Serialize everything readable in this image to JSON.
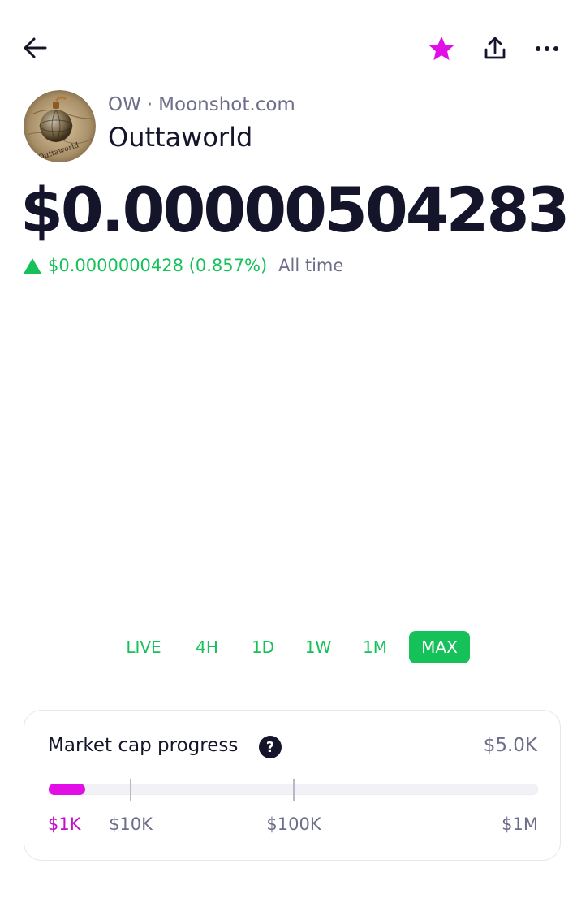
{
  "header": {
    "back_icon": "arrow-left-icon",
    "favorite_icon": "star-icon",
    "share_icon": "share-icon",
    "more_icon": "more-horizontal-icon",
    "favorite_color": "#e10ee6"
  },
  "token": {
    "symbol": "OW",
    "separator": "·",
    "source": "Moonshot.com",
    "name": "Outtaworld",
    "avatar_label": "Outtaworld"
  },
  "price": {
    "current": "$0.00000504283",
    "change": "$0.0000000428 (0.857%)",
    "period": "All time",
    "direction": "up",
    "up_color": "#16c159"
  },
  "range_tabs": {
    "items": [
      {
        "label": "LIVE",
        "active": false
      },
      {
        "label": "4H",
        "active": false
      },
      {
        "label": "1D",
        "active": false
      },
      {
        "label": "1W",
        "active": false
      },
      {
        "label": "1M",
        "active": false
      },
      {
        "label": "MAX",
        "active": true
      }
    ]
  },
  "market_cap": {
    "title": "Market cap progress",
    "help_icon": "question-circle-icon",
    "value": "$5.0K",
    "progress_fraction": 0.074,
    "progress_color": "#e10ee6",
    "scale": [
      "$1K",
      "$10K",
      "$100K",
      "$1M"
    ]
  }
}
